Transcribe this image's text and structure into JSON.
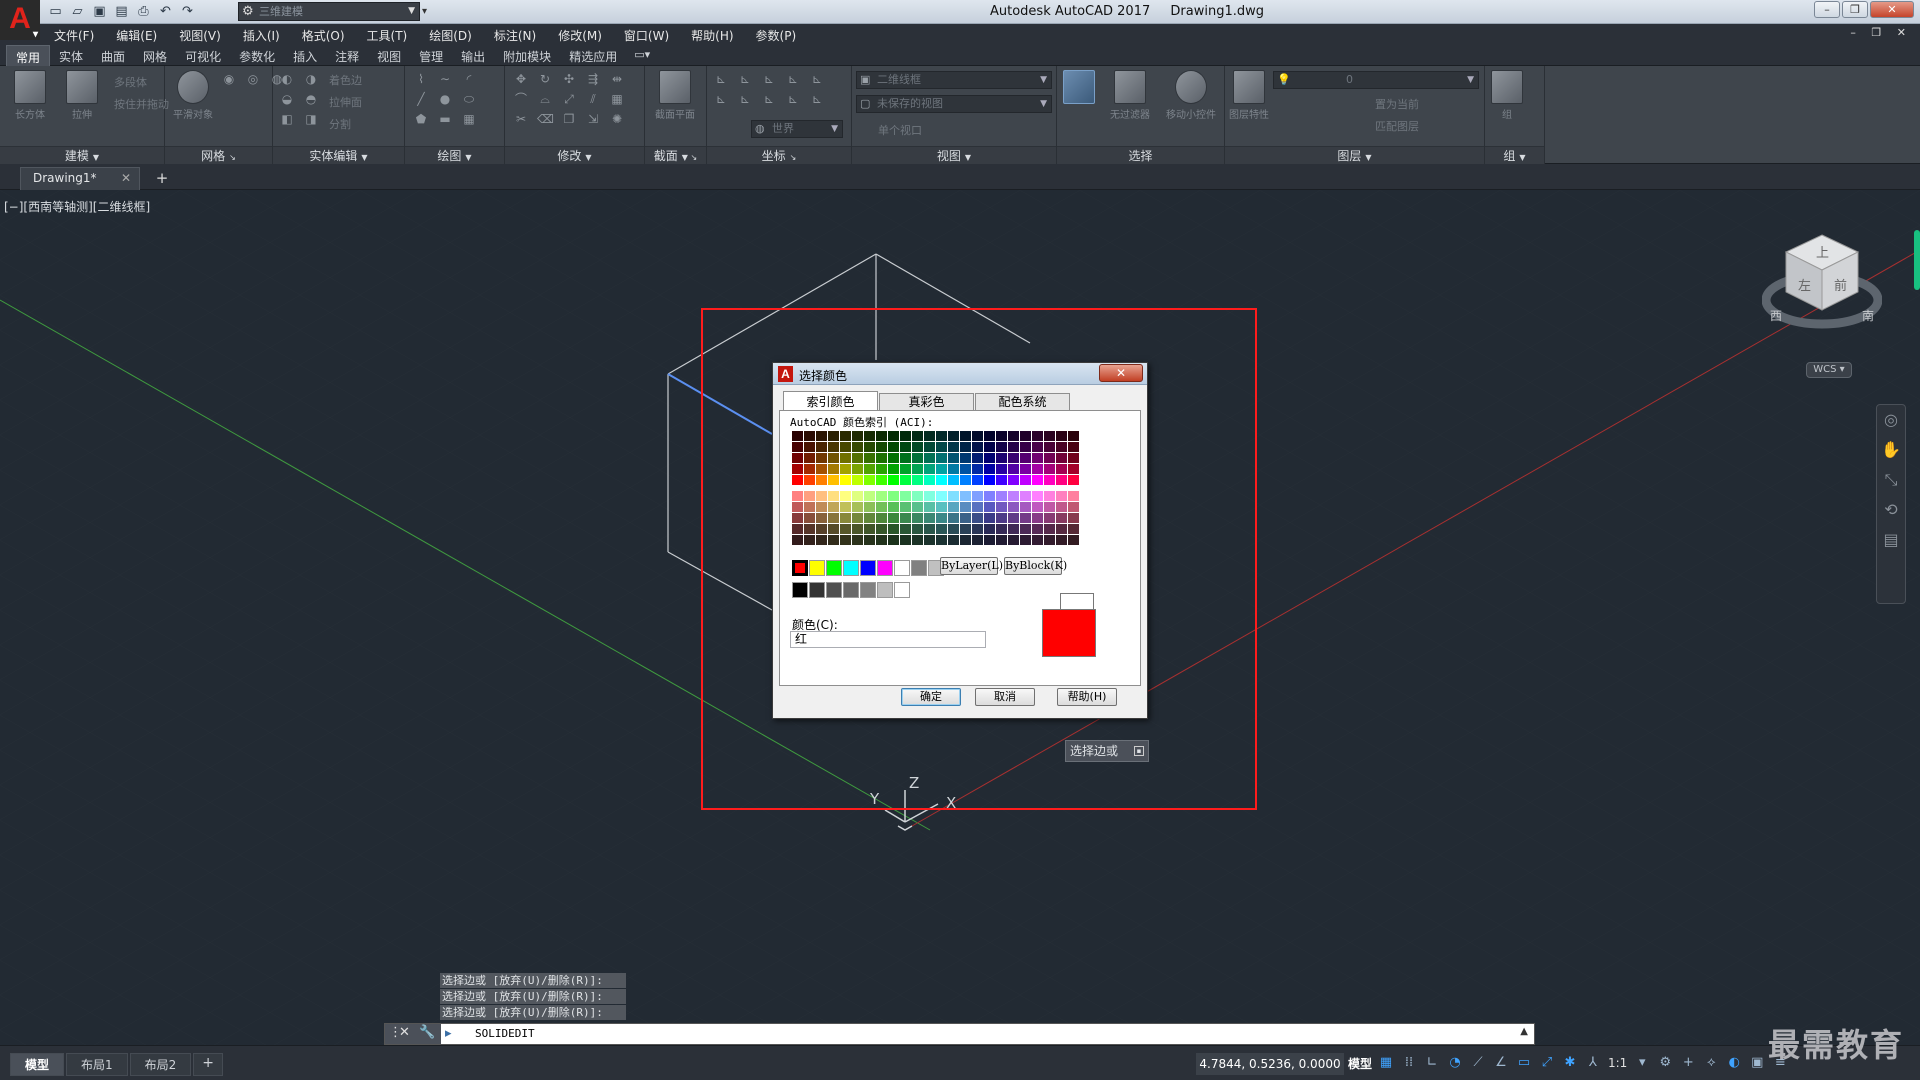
{
  "titlebar": {
    "workspace": "三维建模",
    "app_name": "Autodesk AutoCAD 2017",
    "file_name": "Drawing1.dwg"
  },
  "menu": [
    "文件(F)",
    "编辑(E)",
    "视图(V)",
    "插入(I)",
    "格式(O)",
    "工具(T)",
    "绘图(D)",
    "标注(N)",
    "修改(M)",
    "窗口(W)",
    "帮助(H)",
    "参数(P)"
  ],
  "ribbon_tabs": [
    "常用",
    "实体",
    "曲面",
    "网格",
    "可视化",
    "参数化",
    "插入",
    "注释",
    "视图",
    "管理",
    "输出",
    "附加模块",
    "精选应用"
  ],
  "ribbon": {
    "panels": {
      "modeling": "建模",
      "mesh": "网格",
      "solid_edit": "实体编辑",
      "draw": "绘图",
      "modify": "修改",
      "section": "截面",
      "coordinates": "坐标",
      "view": "视图",
      "selection": "选择",
      "layers": "图层",
      "groups": "组"
    },
    "tools": {
      "box": "长方体",
      "extrude": "拉伸",
      "polysolid": "多段体",
      "presspull": "按住并拖动",
      "smooth_object": "平滑对象",
      "color_edges": "着色边",
      "extrude_faces": "拉伸面",
      "separate": "分割",
      "section_plane": "截面平面",
      "visual_style": "二维线框",
      "unsaved_view": "未保存的视图",
      "ucs_world": "世界",
      "single_viewport": "单个视口",
      "culling": "无过滤器",
      "move_gizmo": "移动小控件",
      "layer_props": "图层特性",
      "layer_name": "0",
      "set_current": "置为当前",
      "match_layer": "匹配图层",
      "group": "组"
    }
  },
  "doc_tab": "Drawing1*",
  "viewport": {
    "controls": "[−][西南等轴测][二维线框]",
    "viewcube_faces": {
      "top": "上",
      "left": "左",
      "front": "前"
    },
    "compass": {
      "west": "西",
      "south": "南"
    },
    "wcs": "WCS ▾",
    "axes": {
      "x": "X",
      "y": "Y",
      "z": "Z"
    }
  },
  "dialog": {
    "title": "选择颜色",
    "close": "✕",
    "tabs": [
      "索引颜色",
      "真彩色",
      "配色系统"
    ],
    "aci_label": "AutoCAD 颜色索引 (ACI):",
    "bylayer": "ByLayer(L)",
    "byblock": "ByBlock(K)",
    "color_label": "颜色(C):",
    "color_value": "红",
    "ok": "确定",
    "cancel": "取消",
    "help": "帮助(H)",
    "selected_color": "#ff0000"
  },
  "tooltip": "选择边或",
  "command": {
    "history": [
      "选择边或 [放弃(U)/删除(R)]:",
      "选择边或 [放弃(U)/删除(R)]:",
      "选择边或 [放弃(U)/删除(R)]:"
    ],
    "input": "SOLIDEDIT"
  },
  "status": {
    "layouts": [
      "模型",
      "布局1",
      "布局2"
    ],
    "coords": "4.7844, 0.5236, 0.0000",
    "model": "模型",
    "scale": "1:1"
  },
  "watermark": "最需教育"
}
